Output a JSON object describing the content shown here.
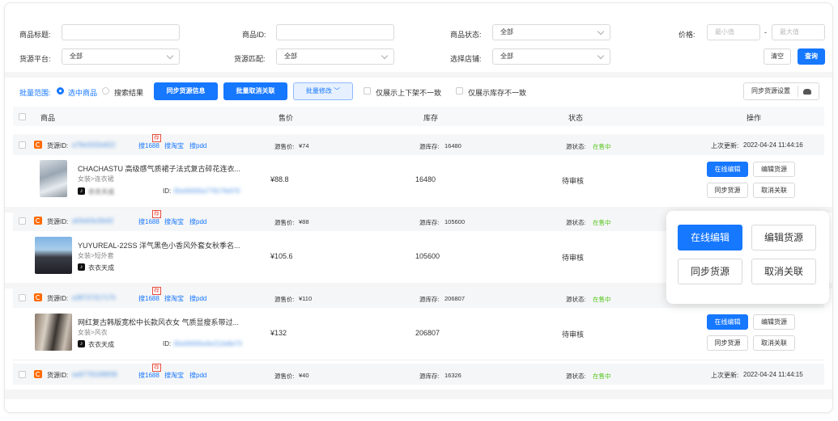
{
  "filters": {
    "title_label": "商品标题:",
    "id_label": "商品ID:",
    "status_label": "商品状态:",
    "status_value": "全部",
    "price_label": "价格:",
    "price_min_ph": "最小值",
    "price_dash": "-",
    "price_max_ph": "最大值",
    "platform_label": "货源平台:",
    "platform_value": "全部",
    "match_label": "货源匹配:",
    "match_value": "全部",
    "shop_label": "选择店铺:",
    "shop_value": "全部",
    "clear_label": "清空",
    "search_label": "查询"
  },
  "batch": {
    "scope_label": "批量范围:",
    "selected_label": "选中商品",
    "results_label": "搜索结果",
    "sync_label": "同步货源信息",
    "unlink_label": "批量取消关联",
    "edit_label": "批量修改",
    "only_shelf_label": "仅展示上下架不一致",
    "only_stock_label": "仅展示库存不一致",
    "settings_label": "同步货源设置"
  },
  "table": {
    "headers": [
      "商品",
      "售价",
      "库存",
      "状态",
      "操作"
    ]
  },
  "source_labels": {
    "source_id": "货源ID:",
    "search_1688": "搜1688",
    "search_taobao": "搜淘宝",
    "search_pdd": "搜pdd",
    "hot": "荐",
    "source_price": "源售价:",
    "source_stock": "源库存:",
    "source_status": "源状态:",
    "on_sale": "在售中",
    "last_update": "上次更新:",
    "id_prefix": "ID:"
  },
  "rows": [
    {
      "source_id": "a79e3332e822",
      "source_price": "¥74",
      "source_stock": "16480",
      "last_update": "2022-04-24 11:44:16",
      "title": "CHACHASTU 高级感气质裙子法式复古碎花连衣...",
      "category": "女装>连衣裙",
      "shop": "衣衣天成",
      "item_id": "35e00005a77917fe070",
      "price": "¥88.8",
      "stock": "16480",
      "status": "待审核"
    },
    {
      "source_id": "a03e63e3fe92",
      "source_price": "¥88",
      "source_stock": "105600",
      "title": "YUYUREAL-22SS 洋气黑色小香风外套女秋季名...",
      "category": "女装>短外套",
      "shop": "衣衣天成",
      "item_id": "35e00005e3e88385e36",
      "price": "¥105.6",
      "stock": "105600",
      "status": "待审核"
    },
    {
      "source_id": "a38737317170",
      "source_price": "¥110",
      "source_stock": "206807",
      "title": "网红复古韩版宽松中长款风衣女 气质显瘦系带过...",
      "category": "女装>风衣",
      "shop": "衣衣天成",
      "item_id": "35e00005e3e212e8e73",
      "price": "¥132",
      "stock": "206807",
      "status": "待审核"
    },
    {
      "source_id": "aa97781089f38",
      "source_price": "¥40",
      "source_stock": "16326",
      "last_update": "2022-04-24 11:44:15"
    }
  ],
  "actions": {
    "edit_online": "在线编辑",
    "edit_source": "编辑货源",
    "sync_source": "同步货源",
    "unlink": "取消关联"
  },
  "colors": {
    "primary": "#1677ff",
    "success": "#52c41a",
    "brand_orange": "#ff6a00"
  }
}
